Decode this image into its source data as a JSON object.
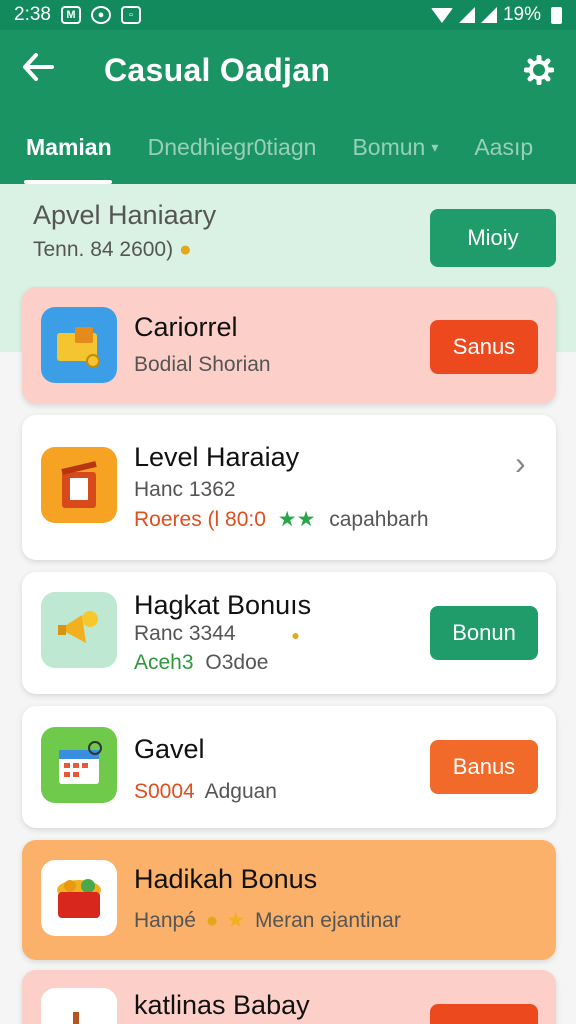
{
  "status_bar": {
    "time": "2:38",
    "battery_text": "19%"
  },
  "app_bar": {
    "title": "Casual Oadjan"
  },
  "tabs": [
    {
      "label": "Mamian"
    },
    {
      "label": "Dnedhiegr0tiagn"
    },
    {
      "label": "Bomun"
    },
    {
      "label": "Aasıp"
    }
  ],
  "hero": {
    "title": "Apvel Haniaary",
    "subtitle": "Tenn. 84 2600)",
    "button": "Mioiy"
  },
  "cards": [
    {
      "title": "Cariorrel",
      "subtitle": "Bodial Shorian",
      "button": "Sanus"
    },
    {
      "title": "Level Haraiay",
      "subtitle": "Hanc 1362",
      "meta_left": "Roeres (l 80:0",
      "meta_right": "capahbarh"
    },
    {
      "title": "Hagkat Bonuıs",
      "subtitle": "Ranc 3344",
      "meta_left": "Aceh3",
      "meta_right": "O3doe",
      "button": "Bonun"
    },
    {
      "title": "Gavel",
      "subtitle": "S0004",
      "meta_right": "Adguan",
      "button": "Banus"
    },
    {
      "title": "Hadikah Bonus",
      "subtitle": "Hanpé",
      "meta_right": "Meran ejantinar"
    },
    {
      "title": "katlinas Babay"
    }
  ],
  "colors": {
    "primary": "#1a9463",
    "status_bar": "#138a5e",
    "button_green": "#1f9c6a",
    "button_orange": "#f26a2a",
    "button_red": "#ec4a1e",
    "card_pink": "#fcd0c8",
    "card_orange": "#fbb16a"
  },
  "icons": [
    "back-arrow-icon",
    "gear-icon",
    "chevron-right-icon",
    "star-icon",
    "coin-icon"
  ]
}
